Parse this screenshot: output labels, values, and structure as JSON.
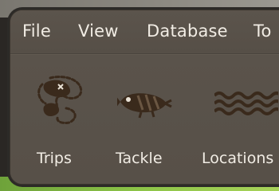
{
  "menubar": {
    "items": [
      {
        "label": "File"
      },
      {
        "label": "View"
      },
      {
        "label": "Database"
      },
      {
        "label": "To"
      }
    ]
  },
  "toolbar": {
    "items": [
      {
        "label": "Trips",
        "icon": "trips-map-icon"
      },
      {
        "label": "Tackle",
        "icon": "fishing-lure-icon"
      },
      {
        "label": "Locations",
        "icon": "water-waves-icon"
      }
    ]
  },
  "colors": {
    "window_bg": "#5b544c",
    "text": "#f1ece4",
    "icon": "#3a2a1c"
  }
}
